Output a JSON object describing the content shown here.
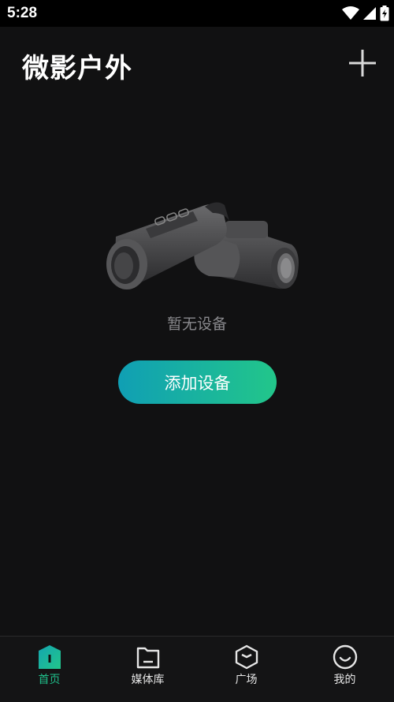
{
  "status_bar": {
    "time": "5:28"
  },
  "header": {
    "title": "微影户外",
    "add_icon": "plus-icon"
  },
  "empty_state": {
    "illustration": "thermal-monocular-device-illustration",
    "message": "暂无设备",
    "button_label": "添加设备"
  },
  "tab_bar": {
    "active_color": "#1fbf8a",
    "tabs": [
      {
        "label": "首页",
        "icon": "home-icon",
        "active": true
      },
      {
        "label": "媒体库",
        "icon": "folder-icon",
        "active": false
      },
      {
        "label": "广场",
        "icon": "cube-icon",
        "active": false
      },
      {
        "label": "我的",
        "icon": "smiley-icon",
        "active": false
      }
    ]
  },
  "colors": {
    "background": "#111112",
    "button_gradient_start": "#109fb4",
    "button_gradient_end": "#22c68a",
    "muted_text": "#8a8a8e"
  }
}
